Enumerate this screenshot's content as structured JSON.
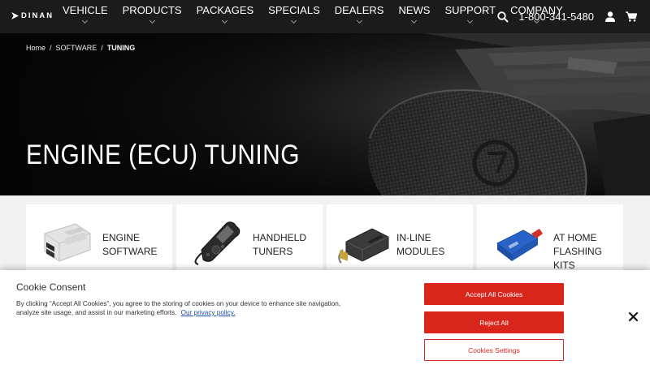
{
  "brand": {
    "logo_text": "DINAN"
  },
  "nav": {
    "items": [
      {
        "label": "VEHICLE"
      },
      {
        "label": "PRODUCTS"
      },
      {
        "label": "PACKAGES"
      },
      {
        "label": "SPECIALS"
      },
      {
        "label": "DEALERS"
      },
      {
        "label": "NEWS"
      },
      {
        "label": "SUPPORT"
      },
      {
        "label": "COMPANY"
      }
    ],
    "phone": "1-800-341-5480",
    "icons": [
      "search-icon",
      "user-icon",
      "cart-icon"
    ]
  },
  "breadcrumb": {
    "home": "Home",
    "separator": "/",
    "software": "SOFTWARE",
    "current": "TUNING"
  },
  "hero": {
    "title": "ENGINE (ECU) TUNING"
  },
  "cards": [
    {
      "line1": "ENGINE",
      "line2": "SOFTWARE",
      "image": "ecu-module"
    },
    {
      "line1": "HANDHELD",
      "line2": "TUNERS",
      "image": "handheld-tuner"
    },
    {
      "line1": "IN-LINE MODULES",
      "line2": "",
      "image": "inline-module"
    },
    {
      "line1": "AT HOME FLASHING",
      "line2": "KITS",
      "image": "obd-flash-cable"
    }
  ],
  "cookie": {
    "title": "Cookie Consent",
    "text": "By clicking “Accept All Cookies”, you agree to the storing of cookies on your device to enhance site navigation, analyze site usage, and assist in our marketing efforts.",
    "link": "Our privacy policy.",
    "accept_label": "Accept All Cookies",
    "reject_label": "Reject All",
    "settings_label": "Cookies Settings",
    "close_symbol": "✕"
  },
  "colors": {
    "accent": "#d9261c",
    "nav_bg": "#1b1b1b",
    "link": "#1a4fa8"
  }
}
